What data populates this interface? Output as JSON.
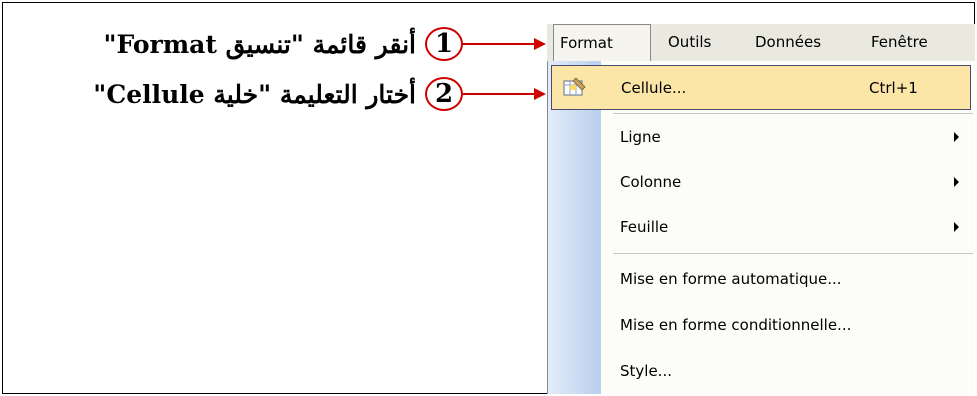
{
  "annotations": {
    "step1_number": "1",
    "step1_text": "أنقر قائمة \"تنسيق Format\"",
    "step2_number": "2",
    "step2_text": "أختار التعليمة \"خلية Cellule\""
  },
  "menubar": {
    "format": "Format",
    "outils": "Outils",
    "donnees": "Données",
    "fenetre": "Fenêtre"
  },
  "menu_items": [
    {
      "label": "Cellule...",
      "shortcut": "Ctrl+1",
      "highlighted": true
    },
    {
      "label": "Ligne",
      "submenu": true
    },
    {
      "label": "Colonne",
      "submenu": true
    },
    {
      "label": "Feuille",
      "submenu": true
    },
    {
      "label": "Mise en forme automatique..."
    },
    {
      "label": "Mise en forme conditionnelle..."
    },
    {
      "label": "Style..."
    }
  ],
  "colors": {
    "annotation_accent": "#d00000",
    "highlight": "#fbe6a8"
  },
  "icons": {
    "cellule": "format-cells-icon",
    "submenu": "submenu-arrow-icon"
  }
}
